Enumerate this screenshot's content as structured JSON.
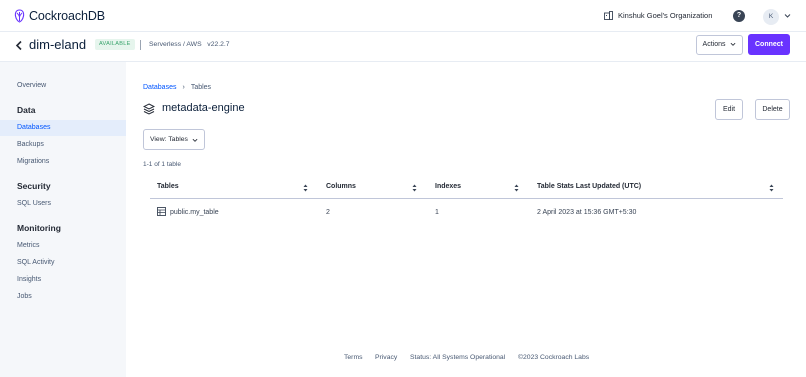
{
  "brand": {
    "name": "CockroachDB",
    "accent": "#6933ff",
    "link": "#0055ff"
  },
  "topbar": {
    "org_name": "Kinshuk Goel's Organization",
    "help_label": "?",
    "avatar_initial": "K"
  },
  "cluster": {
    "name": "dim-eland",
    "status": "AVAILABLE",
    "meta": "Serverless / AWS   v22.2.7",
    "actions_label": "Actions",
    "connect_label": "Connect"
  },
  "sidebar": {
    "overview": "Overview",
    "data_heading": "Data",
    "databases": "Databases",
    "backups": "Backups",
    "migrations": "Migrations",
    "security_heading": "Security",
    "sql_users": "SQL Users",
    "monitoring_heading": "Monitoring",
    "metrics": "Metrics",
    "sql_activity": "SQL Activity",
    "insights": "Insights",
    "jobs": "Jobs"
  },
  "breadcrumb": {
    "databases": "Databases",
    "separator": "›",
    "tables": "Tables"
  },
  "page": {
    "title": "metadata-engine",
    "edit_label": "Edit",
    "delete_label": "Delete",
    "view_label": "View: Tables",
    "count_text": "1-1 of 1 table"
  },
  "table": {
    "columns": [
      "Tables",
      "Columns",
      "Indexes",
      "Table Stats Last Updated (UTC)"
    ],
    "rows": [
      {
        "name": "public.my_table",
        "columns": "2",
        "indexes": "1",
        "updated": "2 April 2023 at 15:36 GMT+5:30"
      }
    ]
  },
  "footer": {
    "terms": "Terms",
    "privacy": "Privacy",
    "status": "Status: All Systems Operational",
    "copyright": "©2023 Cockroach Labs"
  }
}
